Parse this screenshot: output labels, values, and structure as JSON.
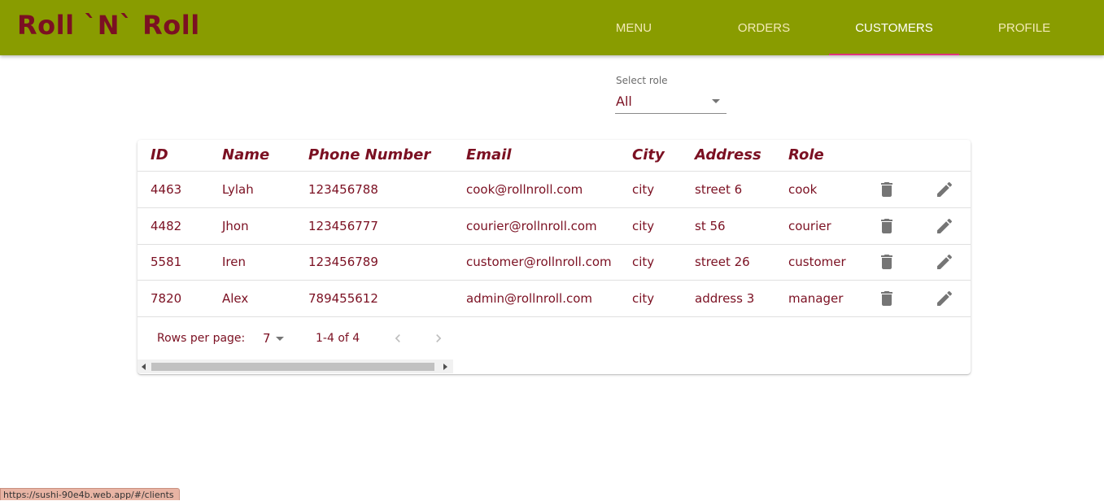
{
  "app": {
    "logo": "Roll `N` Roll"
  },
  "nav": {
    "items": [
      {
        "label": "MENU"
      },
      {
        "label": "ORDERS"
      },
      {
        "label": "CUSTOMERS"
      },
      {
        "label": "PROFILE"
      }
    ],
    "active": "CUSTOMERS",
    "active_indicator_color": "#e0357c"
  },
  "filter": {
    "label": "Select role",
    "value": "All"
  },
  "table": {
    "columns": [
      "ID",
      "Name",
      "Phone Number",
      "Email",
      "City",
      "Address",
      "Role"
    ],
    "rows": [
      {
        "id": "4463",
        "name": "Lylah",
        "phone": "123456788",
        "email": "cook@rollnroll.com",
        "city": "city",
        "address": "street 6",
        "role": "cook"
      },
      {
        "id": "4482",
        "name": "Jhon",
        "phone": "123456777",
        "email": "courier@rollnroll.com",
        "city": "city",
        "address": "st 56",
        "role": "courier"
      },
      {
        "id": "5581",
        "name": "Iren",
        "phone": "123456789",
        "email": "customer@rollnroll.com",
        "city": "city",
        "address": "street 26",
        "role": "customer"
      },
      {
        "id": "7820",
        "name": "Alex",
        "phone": "789455612",
        "email": "admin@rollnroll.com",
        "city": "city",
        "address": "address 3",
        "role": "manager"
      }
    ],
    "row_actions": [
      "delete-icon",
      "edit-icon"
    ]
  },
  "pagination": {
    "rows_per_page_label": "Rows per page:",
    "rows_per_page": "7",
    "range": "1-4 of 4"
  },
  "status_bar": {
    "url": "https://sushi-90e4b.web.app/#/clients"
  },
  "colors": {
    "appbar": "#899c00",
    "brand_text": "#7b1022",
    "nav_text": "#f3e9b5"
  }
}
